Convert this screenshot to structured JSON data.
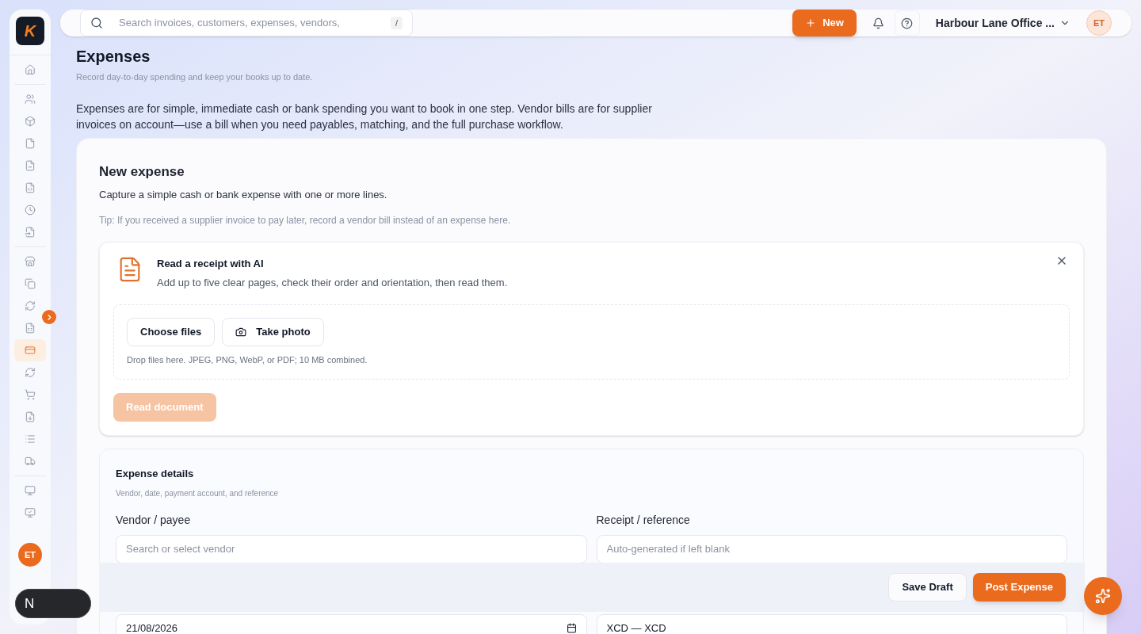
{
  "sidebar": {
    "logo": "K",
    "groups": [
      {
        "items": [
          {
            "selected": false
          }
        ]
      },
      {
        "items": [
          {
            "selected": false
          },
          {
            "selected": false
          },
          {
            "selected": false
          },
          {
            "selected": false
          },
          {
            "selected": false
          },
          {
            "selected": false
          },
          {
            "selected": false
          }
        ]
      },
      {
        "items": [
          {
            "selected": false
          },
          {
            "selected": false
          },
          {
            "selected": false
          },
          {
            "selected": false
          },
          {
            "selected": true
          },
          {
            "selected": false
          },
          {
            "selected": false
          },
          {
            "selected": false
          },
          {
            "selected": false
          },
          {
            "selected": false
          }
        ]
      },
      {
        "items": [
          {
            "selected": false
          },
          {
            "selected": false
          }
        ]
      }
    ],
    "avatar": "ET",
    "dev_badge": "N"
  },
  "topbar": {
    "search": {
      "placeholder": "Search invoices, customers, expenses, vendors,",
      "shortcut": "/"
    },
    "new_button": "New",
    "organization": "Harbour Lane Office ...",
    "avatar": "ET"
  },
  "page": {
    "title": "Expenses",
    "subtitle": "Record day-to-day spending and keep your books up to date.",
    "intro": "Expenses are for simple, immediate cash or bank spending you want to book in one step. Vendor bills are for supplier invoices on account—use a bill when you need payables, matching, and the full purchase workflow."
  },
  "card": {
    "title": "New expense",
    "description": "Capture a simple cash or bank expense with one or more lines.",
    "tip": "Tip: If you received a supplier invoice to pay later, record a vendor bill instead of an expense here.",
    "receipt_ai": {
      "title": "Read a receipt with AI",
      "description": "Add up to five clear pages, check their order and orientation, then read them.",
      "choose_files": "Choose files",
      "take_photo": "Take photo",
      "hint": "Drop files here. JPEG, PNG, WebP, or PDF; 10 MB combined.",
      "read_button": {
        "label": "Read document",
        "disabled": true
      }
    },
    "details": {
      "title": "Expense details",
      "subtitle": "Vendor, date, payment account, and reference",
      "fields": [
        {
          "label": "Vendor / payee",
          "placeholder": "Search or select vendor"
        },
        {
          "label": "Receipt / reference",
          "placeholder": "Auto-generated if left blank"
        }
      ],
      "date_value": "21/08/2026",
      "currency_value": "XCD — XCD"
    }
  },
  "actions": {
    "save_draft": "Save Draft",
    "post": "Post Expense"
  }
}
